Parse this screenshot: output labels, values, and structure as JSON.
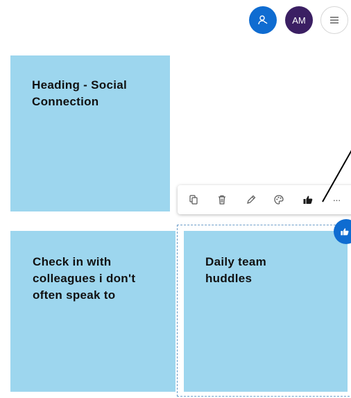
{
  "colors": {
    "note_fill": "#9dd6ee",
    "accent_blue": "#0f6cd1",
    "avatar_purple": "#3b1f63",
    "icon_gray": "#555555",
    "icon_dark": "#1a1a1a"
  },
  "header": {
    "avatars": [
      {
        "icon": "person-icon"
      },
      {
        "initials": "AM"
      }
    ],
    "menu_icon": "hamburger-menu-icon"
  },
  "toolbar": {
    "tools": [
      {
        "icon": "copy-icon"
      },
      {
        "icon": "delete-icon"
      },
      {
        "icon": "edit-icon"
      },
      {
        "icon": "color-palette-icon"
      },
      {
        "icon": "like-icon"
      },
      {
        "icon": "more-icon",
        "glyph": "···"
      }
    ]
  },
  "notes": [
    {
      "text": "Heading - Social\nConnection"
    },
    {
      "text": "Check in with\ncolleagues i don't\noften speak to"
    },
    {
      "text": "Daily team\nhuddles",
      "selected": true
    }
  ],
  "reaction_badge": {
    "icon": "like-icon"
  }
}
